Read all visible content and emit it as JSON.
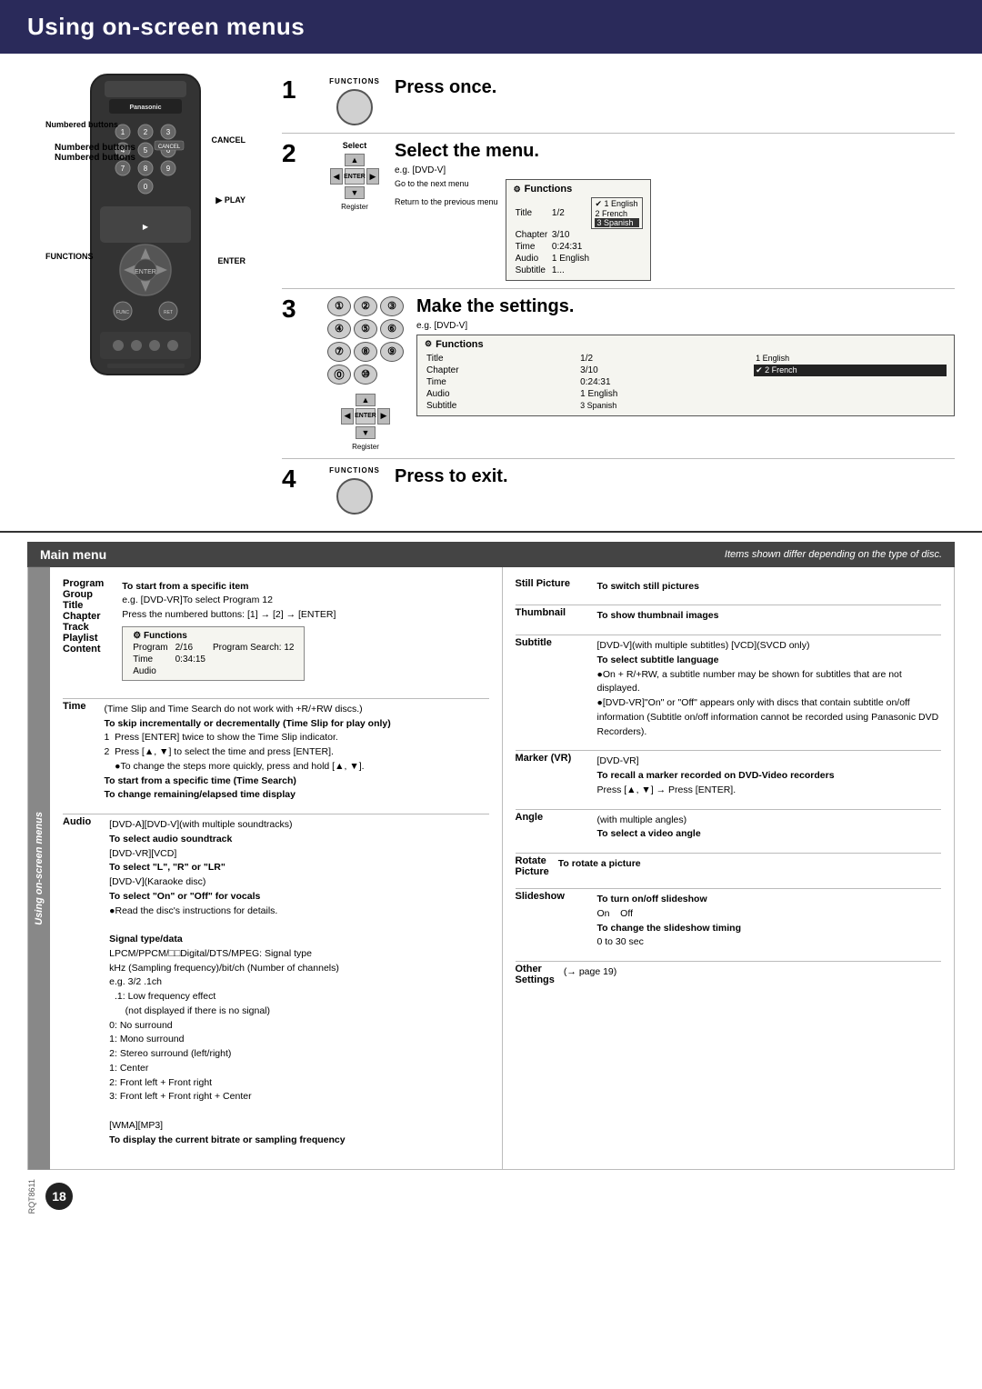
{
  "page": {
    "title": "Using on-screen menus",
    "number": "18",
    "rqt_code": "RQT8611"
  },
  "header": {
    "title": "Using on-screen menus"
  },
  "steps": [
    {
      "number": "1",
      "title": "Press once.",
      "label": "FUNCTIONS"
    },
    {
      "number": "2",
      "title": "Select the menu.",
      "eg": "e.g. [DVD-V]",
      "select_label": "Select",
      "go_to_next_menu": "Go to the next menu",
      "register_label": "Register",
      "return_label": "Return to the previous menu",
      "menu": {
        "icon": "Functions",
        "rows": [
          {
            "label": "Title",
            "val": "1/2",
            "opt1": "✔ 1 English",
            "opt2": "2 French",
            "opt3": "3 Spanish"
          },
          {
            "label": "Chapter",
            "val": "3/10"
          },
          {
            "label": "Time",
            "val": "0:24:31"
          },
          {
            "label": "Audio",
            "val": "1 English"
          },
          {
            "label": "Subtitle",
            "val": "1..."
          }
        ]
      }
    },
    {
      "number": "3",
      "title": "Make the settings.",
      "eg": "e.g. [DVD-V]",
      "menu3": {
        "icon": "Functions",
        "rows": [
          {
            "label": "Title",
            "val": "1/2",
            "opt1": "1 English"
          },
          {
            "label": "Chapter",
            "val": "3/10",
            "opt1": "✔ 2 French",
            "selected": true
          },
          {
            "label": "Time",
            "val": "0:24:31"
          },
          {
            "label": "Audio",
            "val": "1 English"
          },
          {
            "label": "Subtitle",
            "val": "3 Spanish"
          }
        ]
      },
      "buttons": [
        [
          "①",
          "②",
          "③"
        ],
        [
          "④",
          "⑤",
          "⑥"
        ],
        [
          "⑦",
          "⑧",
          "⑨"
        ],
        [
          "⓪",
          "⑩"
        ]
      ]
    },
    {
      "number": "4",
      "title": "Press to exit.",
      "label": "FUNCTIONS"
    }
  ],
  "remote_labels": {
    "numbered_buttons": "Numbered buttons",
    "cancel": "CANCEL",
    "play": "▶ PLAY",
    "enter": "ENTER",
    "functions": "FUNCTIONS"
  },
  "main_menu": {
    "header": "Main menu",
    "note": "Items shown differ depending on the type of disc.",
    "side_label": "Using on-screen menus",
    "left_items": [
      {
        "label": "Program",
        "secondary_labels": [
          "Group",
          "Title",
          "Chapter",
          "Track",
          "Playlist",
          "Content"
        ],
        "desc": "To start from a specific item",
        "desc2": "e.g. [DVD-VR]To select Program 12\nPress the numbered buttons: [1] → [2] → [ENTER]",
        "func_box": {
          "rows": [
            [
              "Functions",
              ""
            ],
            [
              "Program",
              "2/16",
              "Program Search: 12"
            ],
            [
              "Time",
              "0:34:15"
            ],
            [
              "Audio",
              ""
            ]
          ]
        }
      },
      {
        "label": "Time",
        "desc_bold": "(Time Slip and Time Search do not work with +R/+RW discs.)",
        "desc": "To skip incrementally or decrementally (Time Slip for play only)",
        "steps": [
          "Press [ENTER] twice to show the Time Slip indicator.",
          "Press [▲, ▼] to select the time and press [ENTER].",
          "• To change the steps more quickly, press and hold [▲, ▼]."
        ],
        "desc2_bold": "To start from a specific time (Time Search)\nTo change remaining/elapsed time display"
      },
      {
        "label": "Audio",
        "desc_dvda": "[DVD-A][DVD-V](with multiple soundtracks)",
        "desc_dvda_bold": "To select audio soundtrack",
        "desc_dvdvr": "[DVD-VR][VCD]",
        "desc_dvdvr_bold": "To select \"L\", \"R\" or \"LR\"",
        "desc_dvdv_karaoke": "[DVD-V](Karaoke disc)",
        "desc_dvdv_karaoke_bold": "To select \"On\" or \"Off\" for vocals",
        "desc_read": "• Read the disc's instructions for details.",
        "signal_bold": "Signal type/data",
        "signal_desc": "LPCM/PPCM/□□Digital/DTS/MPEG: Signal type\nkHz (Sampling frequency)/bit/ch (Number of channels)",
        "eg": "e.g. 3/2 .1ch",
        "channel_desc": [
          ".1: Low frequency effect",
          "    (not displayed if there is no signal)",
          "0: No surround",
          "1: Mono surround",
          "2: Stereo surround (left/right)",
          "1: Center",
          "2: Front left + Front right",
          "3: Front left + Front right + Center"
        ],
        "wma_bold": "[WMA][MP3]",
        "wma_desc": "To display the current bitrate or sampling frequency"
      }
    ],
    "right_items": [
      {
        "label": "Still Picture",
        "desc_bold": "To switch still pictures"
      },
      {
        "label": "Thumbnail",
        "desc_bold": "To show thumbnail images"
      },
      {
        "label": "Subtitle",
        "desc": "[DVD-V](with multiple subtitles) [VCD](SVCD only)",
        "desc_bold": "To select subtitle language",
        "bullets": [
          "On + R/+RW, a subtitle number may be shown for subtitles that are not displayed.",
          "[DVD-VR]\"On\" or \"Off\" appears only with discs that contain subtitle on/off information (Subtitle on/off information cannot be recorded using Panasonic DVD Recorders)."
        ]
      },
      {
        "label": "Marker (VR)",
        "desc": "[DVD-VR]",
        "desc_bold": "To recall a marker recorded on DVD-Video recorders",
        "desc2": "Press [▲, ▼] → Press [ENTER]."
      },
      {
        "label": "Angle",
        "desc": "(with multiple angles)",
        "desc_bold": "To select a video angle"
      },
      {
        "label": "Rotate Picture",
        "desc_bold": "To rotate a picture"
      },
      {
        "label": "Slideshow",
        "desc_bold1": "To turn on/off slideshow",
        "on_off": "On    Off",
        "desc_bold2": "To change the slideshow timing",
        "timing": "0 to 30 sec"
      },
      {
        "label": "Other Settings",
        "desc": "(→ page 19)"
      }
    ]
  }
}
